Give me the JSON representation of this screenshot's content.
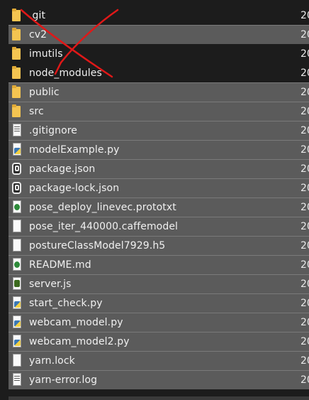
{
  "files": [
    {
      "name": ".git",
      "type": "folder",
      "date": "20",
      "selected": false
    },
    {
      "name": "cv2",
      "type": "folder",
      "date": "20",
      "selected": true
    },
    {
      "name": "imutils",
      "type": "folder",
      "date": "20",
      "selected": false
    },
    {
      "name": "node_modules",
      "type": "folder",
      "date": "20",
      "selected": false
    },
    {
      "name": "public",
      "type": "folder",
      "date": "20",
      "selected": true
    },
    {
      "name": "src",
      "type": "folder",
      "date": "20",
      "selected": true
    },
    {
      "name": ".gitignore",
      "type": "txt",
      "date": "20",
      "selected": true
    },
    {
      "name": "modelExample.py",
      "type": "py",
      "date": "20",
      "selected": true
    },
    {
      "name": "package.json",
      "type": "json",
      "date": "20",
      "selected": true
    },
    {
      "name": "package-lock.json",
      "type": "json",
      "date": "20",
      "selected": true
    },
    {
      "name": "pose_deploy_linevec.prototxt",
      "type": "md",
      "date": "20",
      "selected": true
    },
    {
      "name": "pose_iter_440000.caffemodel",
      "type": "blank",
      "date": "20",
      "selected": true
    },
    {
      "name": "postureClassModel7929.h5",
      "type": "blank",
      "date": "20",
      "selected": true
    },
    {
      "name": "README.md",
      "type": "md",
      "date": "20",
      "selected": true
    },
    {
      "name": "server.js",
      "type": "js",
      "date": "20",
      "selected": true
    },
    {
      "name": "start_check.py",
      "type": "py",
      "date": "20",
      "selected": true
    },
    {
      "name": "webcam_model.py",
      "type": "py",
      "date": "20",
      "selected": true
    },
    {
      "name": "webcam_model2.py",
      "type": "py",
      "date": "20",
      "selected": true
    },
    {
      "name": "yarn.lock",
      "type": "blank",
      "date": "20",
      "selected": true
    },
    {
      "name": "yarn-error.log",
      "type": "txt",
      "date": "20",
      "selected": true
    }
  ],
  "icons": {
    "folder": "folder-icon",
    "txt": "text-file-icon",
    "py": "python-file-icon",
    "json": "json-file-icon",
    "md": "markdown-file-icon",
    "js": "javascript-file-icon",
    "blank": "file-icon"
  },
  "colors": {
    "background": "#1c1c1c",
    "selection": "#5b5b5b",
    "folder": "#f4c451",
    "cross_mark": "#e01818"
  }
}
